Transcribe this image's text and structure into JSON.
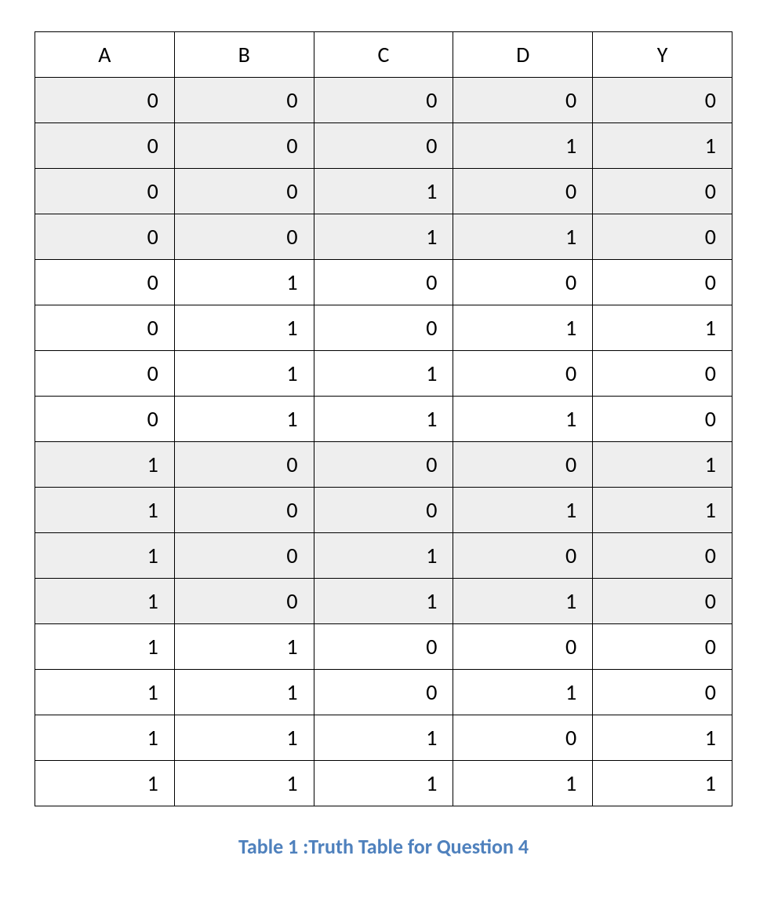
{
  "table": {
    "headers": [
      "A",
      "B",
      "C",
      "D",
      "Y"
    ],
    "rows": [
      {
        "shaded": true,
        "cells": [
          "0",
          "0",
          "0",
          "0",
          "0"
        ]
      },
      {
        "shaded": true,
        "cells": [
          "0",
          "0",
          "0",
          "1",
          "1"
        ]
      },
      {
        "shaded": true,
        "cells": [
          "0",
          "0",
          "1",
          "0",
          "0"
        ]
      },
      {
        "shaded": true,
        "cells": [
          "0",
          "0",
          "1",
          "1",
          "0"
        ]
      },
      {
        "shaded": false,
        "cells": [
          "0",
          "1",
          "0",
          "0",
          "0"
        ]
      },
      {
        "shaded": false,
        "cells": [
          "0",
          "1",
          "0",
          "1",
          "1"
        ]
      },
      {
        "shaded": false,
        "cells": [
          "0",
          "1",
          "1",
          "0",
          "0"
        ]
      },
      {
        "shaded": false,
        "cells": [
          "0",
          "1",
          "1",
          "1",
          "0"
        ]
      },
      {
        "shaded": true,
        "cells": [
          "1",
          "0",
          "0",
          "0",
          "1"
        ]
      },
      {
        "shaded": true,
        "cells": [
          "1",
          "0",
          "0",
          "1",
          "1"
        ]
      },
      {
        "shaded": true,
        "cells": [
          "1",
          "0",
          "1",
          "0",
          "0"
        ]
      },
      {
        "shaded": true,
        "cells": [
          "1",
          "0",
          "1",
          "1",
          "0"
        ]
      },
      {
        "shaded": false,
        "cells": [
          "1",
          "1",
          "0",
          "0",
          "0"
        ]
      },
      {
        "shaded": false,
        "cells": [
          "1",
          "1",
          "0",
          "1",
          "0"
        ]
      },
      {
        "shaded": false,
        "cells": [
          "1",
          "1",
          "1",
          "0",
          "1"
        ]
      },
      {
        "shaded": false,
        "cells": [
          "1",
          "1",
          "1",
          "1",
          "1"
        ]
      }
    ]
  },
  "caption": "Table 1 :Truth Table for Question 4"
}
